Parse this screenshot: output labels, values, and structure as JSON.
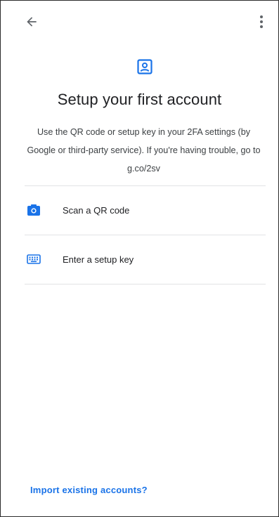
{
  "header": {
    "back_icon": "arrow-left-icon",
    "menu_icon": "more-vert-icon"
  },
  "hero": {
    "icon": "account-box-icon",
    "accent_color": "#1a73e8"
  },
  "title": "Setup your first account",
  "description": "Use the QR code or setup key in your 2FA settings (by Google or third-party service). If you're having trouble, go to g.co/2sv",
  "options": [
    {
      "icon": "camera-icon",
      "label": "Scan a QR code"
    },
    {
      "icon": "keyboard-icon",
      "label": "Enter a setup key"
    }
  ],
  "footer": {
    "import_link": "Import existing accounts?"
  }
}
